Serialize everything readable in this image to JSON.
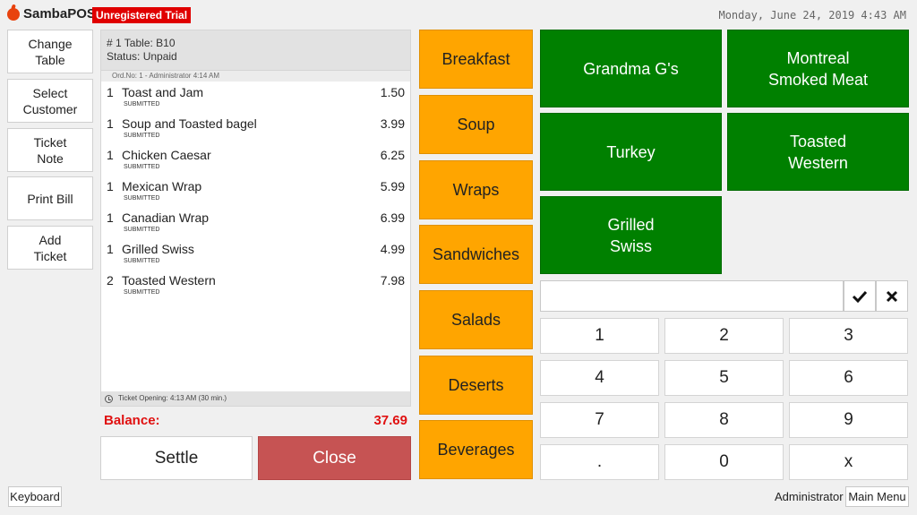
{
  "header": {
    "app_name": "SambaPOS",
    "trial_badge": "Unregistered Trial",
    "datetime": "Monday, June 24, 2019 4:43 AM"
  },
  "side_buttons": [
    {
      "label": "Change\nTable"
    },
    {
      "label": "Select\nCustomer"
    },
    {
      "label": "Ticket\nNote"
    },
    {
      "label": "Print Bill"
    },
    {
      "label": "Add\nTicket"
    }
  ],
  "ticket": {
    "title": "# 1 Table: B10",
    "status": "Status: Unpaid",
    "order_info": "Ord.No: 1 - Administrator 4:14 AM",
    "lines": [
      {
        "qty": "1",
        "name": "Toast and Jam",
        "price": "1.50",
        "status": "SUBMITTED"
      },
      {
        "qty": "1",
        "name": "Soup and Toasted bagel",
        "price": "3.99",
        "status": "SUBMITTED"
      },
      {
        "qty": "1",
        "name": "Chicken Caesar",
        "price": "6.25",
        "status": "SUBMITTED"
      },
      {
        "qty": "1",
        "name": "Mexican Wrap",
        "price": "5.99",
        "status": "SUBMITTED"
      },
      {
        "qty": "1",
        "name": "Canadian Wrap",
        "price": "6.99",
        "status": "SUBMITTED"
      },
      {
        "qty": "1",
        "name": "Grilled Swiss",
        "price": "4.99",
        "status": "SUBMITTED"
      },
      {
        "qty": "2",
        "name": "Toasted Western",
        "price": "7.98",
        "status": "SUBMITTED"
      }
    ],
    "footer": "Ticket Opening:   4:13 AM (30 min.)",
    "balance_label": "Balance:",
    "balance_value": "37.69"
  },
  "actions": {
    "settle": "Settle",
    "close": "Close"
  },
  "categories": [
    "Breakfast",
    "Soup",
    "Wraps",
    "Sandwiches",
    "Salads",
    "Deserts",
    "Beverages"
  ],
  "menu_items": [
    {
      "label": "Grandma G's"
    },
    {
      "label": "Montreal\nSmoked Meat"
    },
    {
      "label": "Turkey"
    },
    {
      "label": "Toasted\nWestern"
    },
    {
      "label": "Grilled\nSwiss"
    }
  ],
  "numpad": {
    "input_value": "",
    "ok_icon": "check-icon",
    "clear_icon": "close-icon",
    "keys": [
      "1",
      "2",
      "3",
      "4",
      "5",
      "6",
      "7",
      "8",
      "9",
      ".",
      "0",
      "x"
    ]
  },
  "footer": {
    "keyboard": "Keyboard",
    "user": "Administrator",
    "main_menu": "Main Menu"
  },
  "colors": {
    "category": "#ffa500",
    "menu_item": "#008000",
    "close_button": "#c65353",
    "balance": "#e01010",
    "trial_badge": "#e00000"
  }
}
